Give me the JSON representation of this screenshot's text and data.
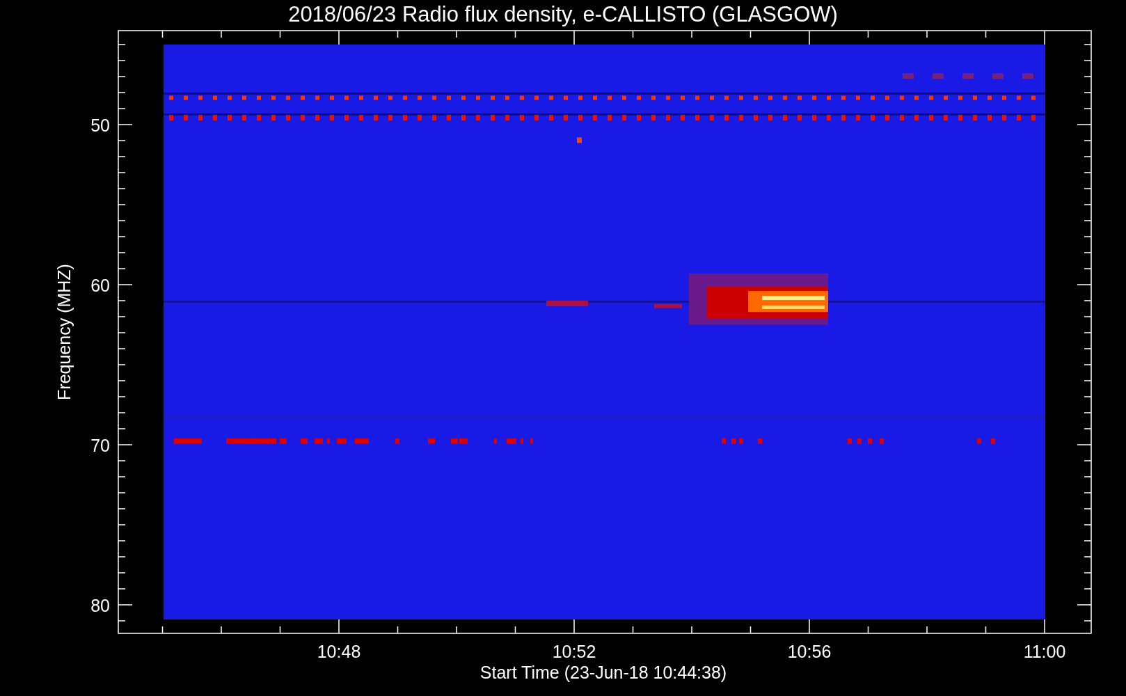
{
  "plot": {
    "title": "2018/06/23  Radio flux density, e-CALLISTO (GLASGOW)",
    "ylabel": "Frequency (MHZ)",
    "xlabel": "Start Time (23-Jun-18 10:44:38)",
    "ytick_labels": [
      "50",
      "60",
      "70",
      "80"
    ],
    "xtick_labels": [
      "10:48",
      "10:52",
      "10:56",
      "11:00"
    ]
  }
}
